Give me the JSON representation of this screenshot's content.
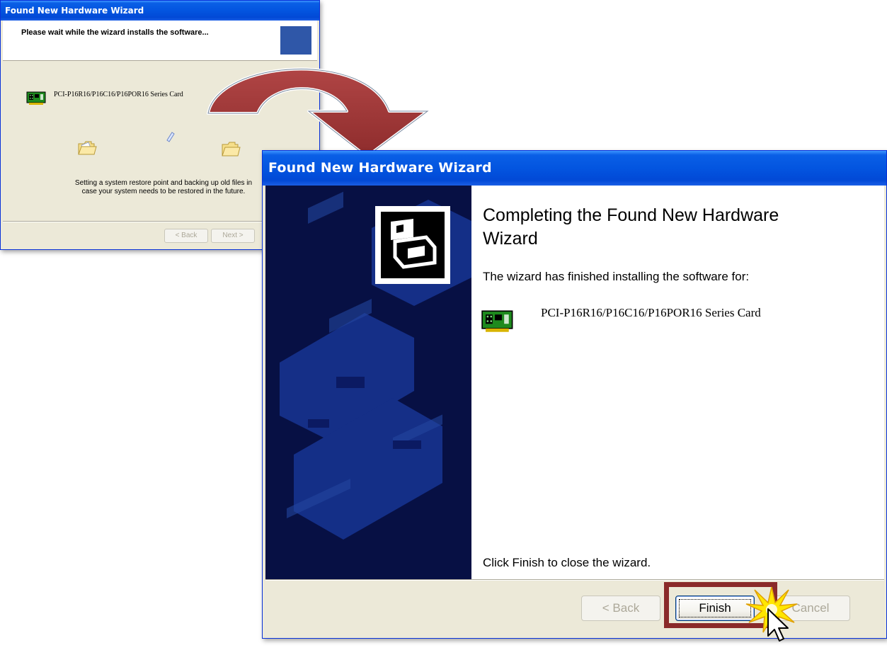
{
  "small_window": {
    "title": "Found New Hardware Wizard",
    "heading": "Please wait while the wizard installs the software...",
    "device_name": "PCI-P16R16/P16C16/P16POR16 Series Card",
    "status_line1": "Setting a system restore point and backing up old files in",
    "status_line2": "case your system needs to be restored in the future.",
    "back_label": "< Back",
    "next_label": "Next >"
  },
  "main_window": {
    "title": "Found New Hardware Wizard",
    "heading": "Completing the Found New Hardware Wizard",
    "subtext": "The wizard has finished installing the software for:",
    "device_name": "PCI-P16R16/P16C16/P16POR16 Series Card",
    "footer_text": "Click Finish to close the wizard.",
    "back_label": "< Back",
    "finish_label": "Finish",
    "cancel_label": "Cancel"
  },
  "colors": {
    "titlebar": "#0355e0",
    "banner": "#071044",
    "arrow": "#9b3434",
    "highlight": "#8a2a2a"
  },
  "icons": [
    "pci-card-icon",
    "folder-icon",
    "document-icon",
    "hardware-wizard-icon",
    "mouse-cursor-icon",
    "click-burst-icon"
  ]
}
